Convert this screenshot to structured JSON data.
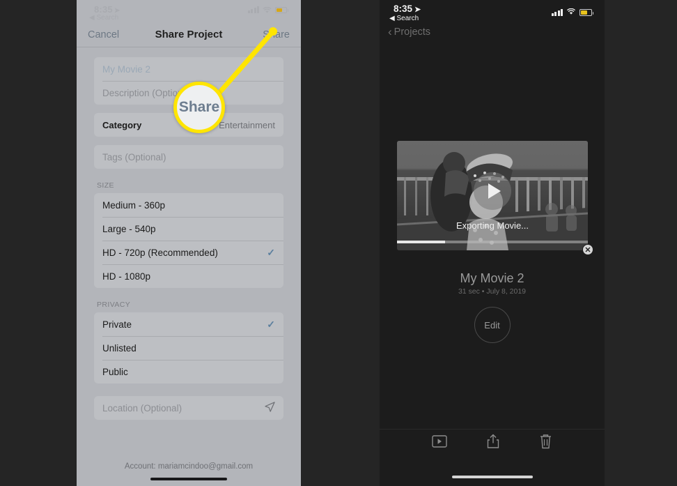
{
  "left_phone": {
    "status_bar": {
      "time": "8:35",
      "location_icon": "location-arrow-icon",
      "back_app": "Search",
      "signal_icon": "cellular-bars-icon",
      "wifi_icon": "wifi-icon",
      "battery_icon": "battery-icon"
    },
    "nav": {
      "cancel": "Cancel",
      "title": "Share Project",
      "share": "Share"
    },
    "fields": {
      "title_value": "My Movie 2",
      "description_placeholder": "Description (Optional)",
      "category_label": "Category",
      "category_value": "Entertainment",
      "tags_placeholder": "Tags (Optional)",
      "location_placeholder": "Location (Optional)",
      "location_icon": "location-arrow-icon"
    },
    "size_section": {
      "header": "SIZE",
      "options": [
        {
          "label": "Medium - 360p",
          "selected": false
        },
        {
          "label": "Large - 540p",
          "selected": false
        },
        {
          "label": "HD - 720p (Recommended)",
          "selected": true
        },
        {
          "label": "HD - 1080p",
          "selected": false
        }
      ]
    },
    "privacy_section": {
      "header": "PRIVACY",
      "options": [
        {
          "label": "Private",
          "selected": true
        },
        {
          "label": "Unlisted",
          "selected": false
        },
        {
          "label": "Public",
          "selected": false
        }
      ]
    },
    "account_text": "Account: mariamcindoo@gmail.com",
    "check_glyph": "✓"
  },
  "callout": {
    "magnifier_label": "Share",
    "ring_color": "#ffe500",
    "line_color": "#ffe500",
    "text_color": "#6d7d8f"
  },
  "right_phone": {
    "status_bar": {
      "time": "8:35",
      "location_icon": "location-arrow-icon",
      "back_app": "Search",
      "signal_icon": "cellular-bars-icon",
      "wifi_icon": "wifi-icon",
      "battery_icon": "battery-icon"
    },
    "back_nav": {
      "label": "Projects",
      "chevron": "‹"
    },
    "video": {
      "play_icon": "play-icon",
      "status_text": "Exporting Movie...",
      "progress_percent": 25,
      "cancel_icon": "close-icon",
      "cancel_glyph": "✕"
    },
    "movie": {
      "title": "My Movie 2",
      "meta": "31 sec • July 8, 2019"
    },
    "edit_button": "Edit",
    "toolbar": [
      {
        "name": "playback-icon"
      },
      {
        "name": "share-icon"
      },
      {
        "name": "trash-icon"
      }
    ]
  }
}
